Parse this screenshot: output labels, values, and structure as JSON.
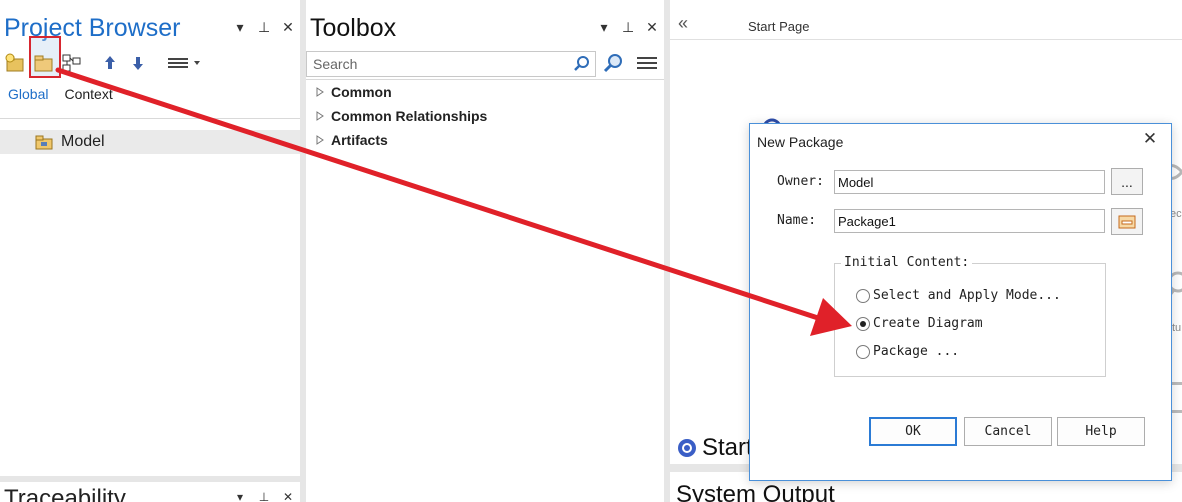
{
  "project_browser": {
    "title": "Project Browser",
    "tabs": [
      {
        "label": "Global",
        "active": true
      },
      {
        "label": "Context",
        "active": false
      }
    ],
    "tree": [
      {
        "label": "Model",
        "selected": true
      }
    ],
    "toolbar_icons": [
      "new-model-icon",
      "new-package-icon",
      "new-diagram-icon",
      "move-up-icon",
      "move-down-icon",
      "menu-icon"
    ]
  },
  "traceability": {
    "title": "Traceability"
  },
  "toolbox": {
    "title": "Toolbox",
    "search_placeholder": "Search",
    "groups": [
      "Common",
      "Common Relationships",
      "Artifacts"
    ]
  },
  "start_page": {
    "tab_label": "Start Page",
    "collapse_glyph": "«",
    "partial_text": [
      "ec",
      "tu"
    ],
    "bottom_title": "Start",
    "system_output": "System Output"
  },
  "dialog": {
    "title": "New Package",
    "close_glyph": "✕",
    "owner_label": "Owner:",
    "owner_value": "Model",
    "owner_button": "...",
    "name_label": "Name:",
    "name_value": "Package1",
    "group_label": "Initial Content:",
    "options": [
      {
        "label": "Select and Apply Mode...",
        "selected": false
      },
      {
        "label": "Create Diagram",
        "selected": true
      },
      {
        "label": "Package ...",
        "selected": false
      }
    ],
    "buttons": {
      "ok": "OK",
      "cancel": "Cancel",
      "help": "Help"
    }
  },
  "colors": {
    "accent": "#1e6ec8",
    "highlight_red": "#d7262f",
    "arrow_red": "#e02129"
  }
}
